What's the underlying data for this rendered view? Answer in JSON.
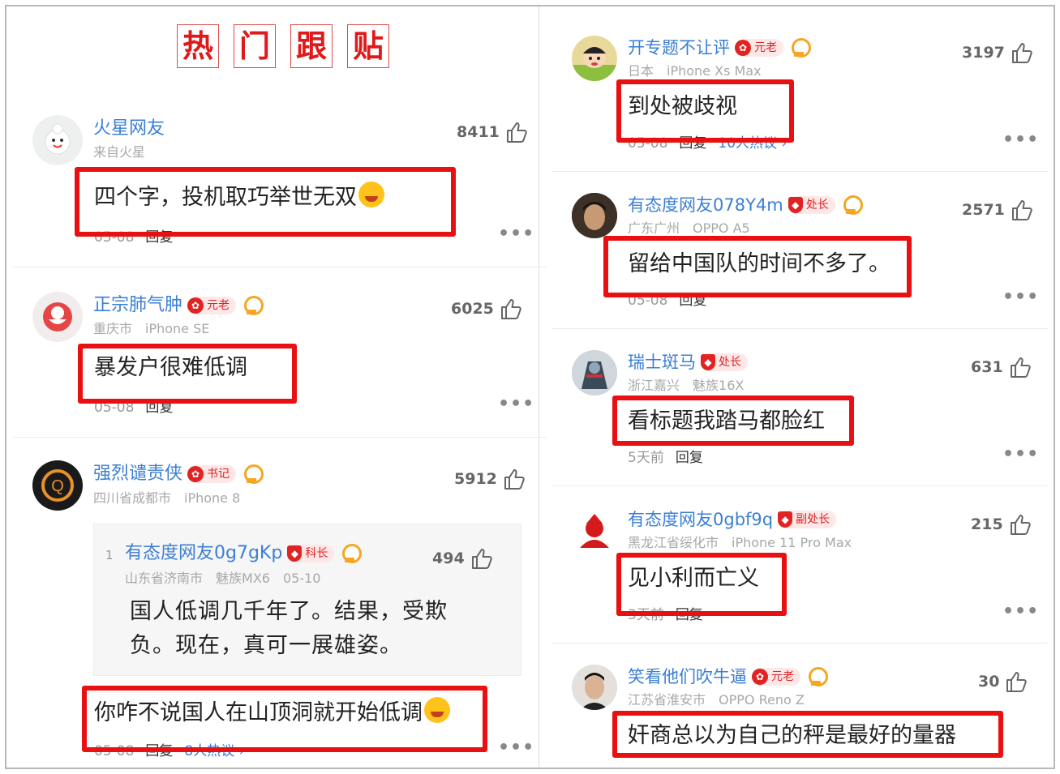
{
  "section_title_chars": [
    "热",
    "门",
    "跟",
    "贴"
  ],
  "left_comments": [
    {
      "name": "火星网友",
      "meta": [
        "来自火星"
      ],
      "likes": "8411",
      "text": "四个字，投机取巧举世无双",
      "date": "05-08",
      "reply_label": "回复"
    },
    {
      "name": "正宗肺气肿",
      "rank": "元老",
      "meta": [
        "重庆市",
        "iPhone SE"
      ],
      "likes": "6025",
      "text": "暴发户很难低调",
      "date": "05-08",
      "reply_label": "回复"
    },
    {
      "name": "强烈谴责侠",
      "rank": "书记",
      "meta": [
        "四川省成都市",
        "iPhone 8"
      ],
      "likes": "5912",
      "nested_reply": {
        "index": "1",
        "name": "有态度网友0g7gKp",
        "rank": "科长",
        "meta": [
          "山东省济南市",
          "魅族MX6",
          "05-10"
        ],
        "likes": "494",
        "text_line1": "国人低调几千年了。结果，受欺",
        "text_line2": "负。现在，真可一展雄姿。"
      },
      "text": "你咋不说国人在山顶洞就开始低调",
      "date": "05-08",
      "reply_label": "回复",
      "hot_label": "8人热议 ›"
    }
  ],
  "right_comments": [
    {
      "name": "开专题不让评",
      "rank": "元老",
      "meta": [
        "日本",
        "iPhone Xs Max"
      ],
      "likes": "3197",
      "text": "到处被歧视",
      "date": "05-08",
      "reply_label": "回复",
      "hot_label": "10人热议 ›"
    },
    {
      "name": "有态度网友078Y4m",
      "rank": "处长",
      "meta": [
        "广东广州",
        "OPPO A5"
      ],
      "likes": "2571",
      "text": "留给中国队的时间不多了。",
      "date": "05-08",
      "reply_label": "回复"
    },
    {
      "name": "瑞士斑马",
      "rank": "处长",
      "meta": [
        "浙江嘉兴",
        "魅族16X"
      ],
      "likes": "631",
      "text": "看标题我踏马都脸红",
      "date": "5天前",
      "reply_label": "回复"
    },
    {
      "name": "有态度网友0gbf9q",
      "rank": "副处长",
      "meta": [
        "黑龙江省绥化市",
        "iPhone 11 Pro Max"
      ],
      "likes": "215",
      "text": "见小利而亡义",
      "date": "3天前",
      "reply_label": "回复"
    },
    {
      "name": "笑看他们吹牛逼",
      "rank": "元老",
      "meta": [
        "江苏省淮安市",
        "OPPO Reno Z"
      ],
      "likes": "30",
      "text": "奸商总以为自己的秤是最好的量器"
    }
  ],
  "more_label": "•••",
  "colors": {
    "username": "#3b7fd4",
    "highlight_box": "#e81010",
    "badge": "#e02323",
    "medal": "#f5a623"
  },
  "icons": [
    "thumbs-up-icon",
    "flower-badge-icon",
    "shield-badge-icon",
    "medal-icon",
    "laughing-emoji-icon"
  ]
}
